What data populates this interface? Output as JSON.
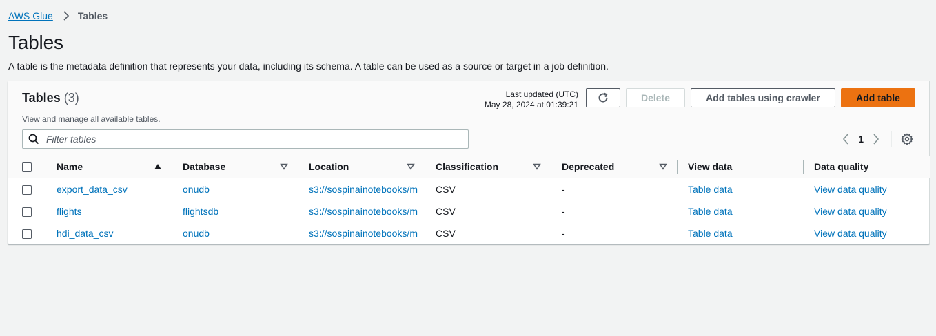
{
  "breadcrumb": {
    "root": "AWS Glue",
    "current": "Tables"
  },
  "page": {
    "title": "Tables",
    "description": "A table is the metadata definition that represents your data, including its schema. A table can be used as a source or target in a job definition."
  },
  "panel": {
    "title": "Tables",
    "count": "(3)",
    "subtitle": "View and manage all available tables.",
    "last_updated_label": "Last updated (UTC)",
    "last_updated_value": "May 28, 2024 at 01:39:21",
    "buttons": {
      "delete": "Delete",
      "crawler": "Add tables using crawler",
      "add": "Add table"
    },
    "filter_placeholder": "Filter tables",
    "page_number": "1"
  },
  "columns": [
    "Name",
    "Database",
    "Location",
    "Classification",
    "Deprecated",
    "View data",
    "Data quality"
  ],
  "rows": [
    {
      "name": "export_data_csv",
      "database": "onudb",
      "location": "s3://sospinainotebooks/m",
      "classification": "CSV",
      "deprecated": "-",
      "view": "Table data",
      "quality": "View data quality"
    },
    {
      "name": "flights",
      "database": "flightsdb",
      "location": "s3://sospinainotebooks/m",
      "classification": "CSV",
      "deprecated": "-",
      "view": "Table data",
      "quality": "View data quality"
    },
    {
      "name": "hdi_data_csv",
      "database": "onudb",
      "location": "s3://sospinainotebooks/m",
      "classification": "CSV",
      "deprecated": "-",
      "view": "Table data",
      "quality": "View data quality"
    }
  ],
  "colors": {
    "link": "#0073bb",
    "primary_button": "#ec7211",
    "background": "#f2f3f3"
  }
}
